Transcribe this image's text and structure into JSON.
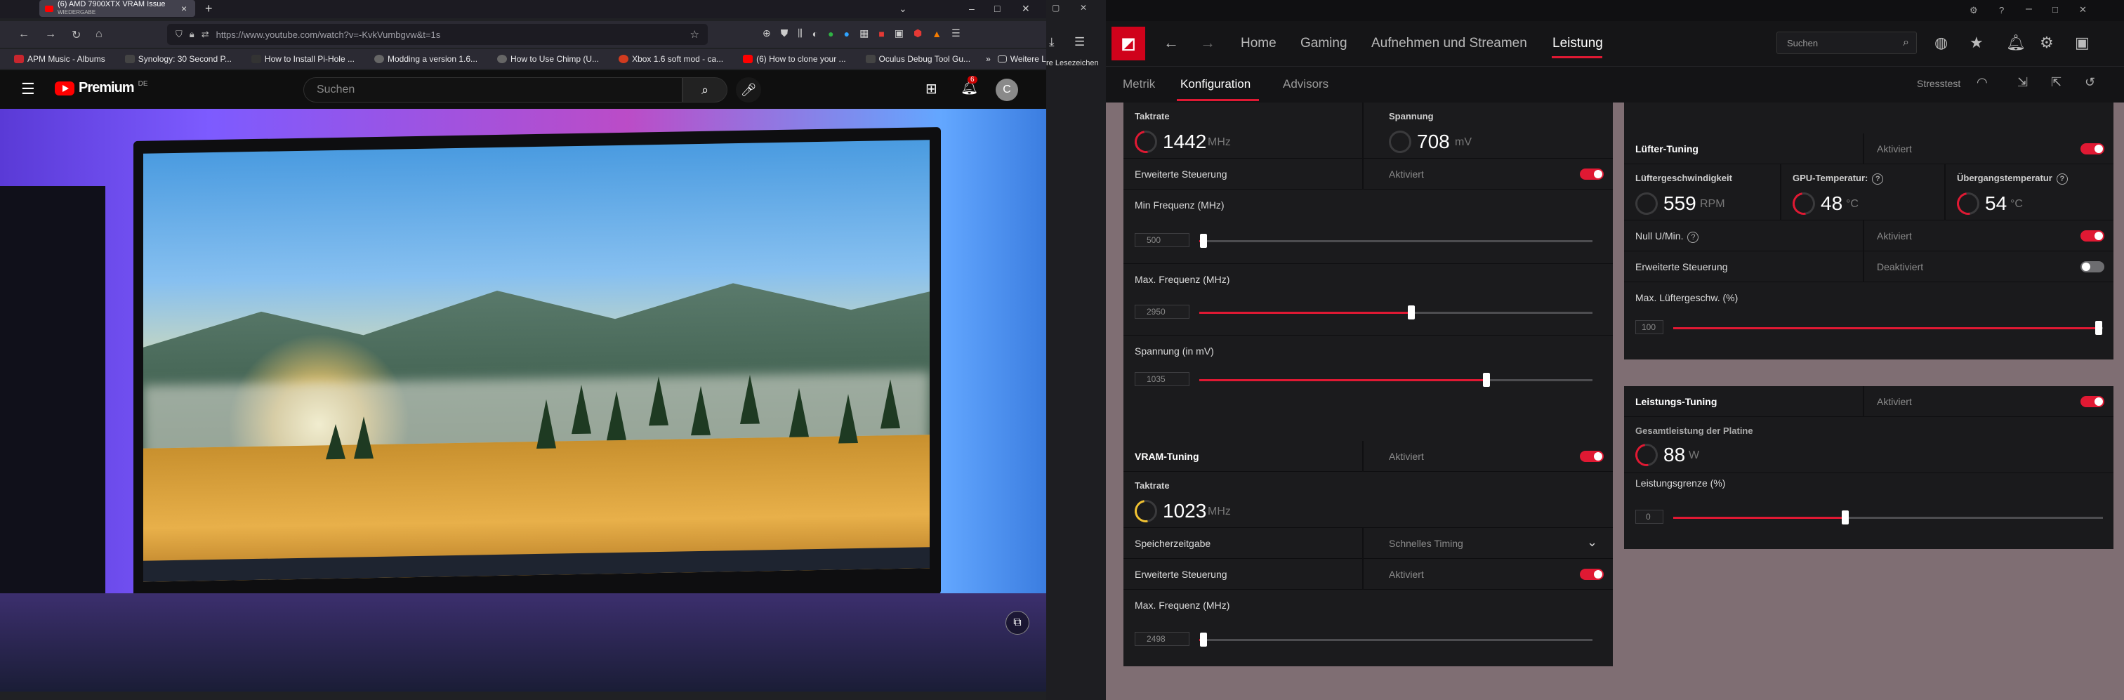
{
  "browser": {
    "tab_title": "(6) AMD 7900XTX VRAM Issue",
    "tab_subtitle": "WIEDERGABE",
    "new_tab": "+",
    "url": "https://www.youtube.com/watch?v=-KvkVumbgvw&t=1s",
    "bookmarks": [
      {
        "label": "APM Music - Albums",
        "color": "#c8262e"
      },
      {
        "label": "Synology: 30 Second P...",
        "color": "#444"
      },
      {
        "label": "How to Install Pi-Hole ...",
        "color": "#333"
      },
      {
        "label": "Modding a version 1.6...",
        "color": "#666"
      },
      {
        "label": "How to Use Chimp (U...",
        "color": "#666"
      },
      {
        "label": "Xbox 1.6 soft mod - ca...",
        "color": "#d13b1f"
      },
      {
        "label": "(6) How to clone your ...",
        "color": "#ff0000"
      },
      {
        "label": "Oculus Debug Tool Gu...",
        "color": "#444"
      }
    ],
    "bookmarks_more": "»",
    "other_bookmarks": "Weitere Lesezeichen",
    "right_fragment": "re Lesezeichen"
  },
  "youtube": {
    "logo_text": "Premium",
    "logo_region": "DE",
    "search_placeholder": "Suchen",
    "notification_count": "6",
    "avatar_letter": "C"
  },
  "amd": {
    "nav": [
      "Home",
      "Gaming",
      "Aufnehmen und Streamen",
      "Leistung"
    ],
    "active_nav": "Leistung",
    "search_placeholder": "Suchen",
    "subnav": [
      "Metrik",
      "Konfiguration",
      "Advisors"
    ],
    "stresstest_label": "Stresstest",
    "gpu": {
      "clock_label": "Taktrate",
      "clock_value": "1442",
      "clock_unit": "MHz",
      "voltage_label": "Spannung",
      "voltage_value": "708",
      "voltage_unit": "mV",
      "adv_label": "Erweiterte Steuerung",
      "adv_status": "Aktiviert",
      "min_freq_label": "Min Frequenz (MHz)",
      "min_freq_value": "500",
      "min_freq_pos": 0.01,
      "max_freq_label": "Max. Frequenz (MHz)",
      "max_freq_value": "2950",
      "max_freq_pos": 0.54,
      "volt_label": "Spannung (in mV)",
      "volt_value": "1035",
      "volt_pos": 0.73
    },
    "vram": {
      "title": "VRAM-Tuning",
      "status": "Aktiviert",
      "clock_label": "Taktrate",
      "clock_value": "1023",
      "clock_unit": "MHz",
      "timing_label": "Speicherzeitgabe",
      "timing_value": "Schnelles Timing",
      "adv_label": "Erweiterte Steuerung",
      "adv_status": "Aktiviert",
      "max_freq_label": "Max. Frequenz (MHz)",
      "max_freq_value": "2498",
      "max_freq_pos": 0.01
    },
    "fan": {
      "title": "Lüfter-Tuning",
      "status": "Aktiviert",
      "speed_label": "Lüftergeschwindigkeit",
      "speed_value": "559",
      "speed_unit": "RPM",
      "gpu_temp_label": "GPU-Temperatur:",
      "gpu_temp_value": "48",
      "gpu_temp_unit": "°C",
      "junction_label": "Übergangstemperatur",
      "junction_value": "54",
      "junction_unit": "°C",
      "zero_rpm_label": "Null U/Min.",
      "zero_rpm_status": "Aktiviert",
      "adv_label": "Erweiterte Steuerung",
      "adv_status": "Deaktiviert",
      "max_speed_label": "Max. Lüftergeschw. (%)",
      "max_speed_value": "100",
      "max_speed_pos": 0.99
    },
    "power": {
      "title": "Leistungs-Tuning",
      "status": "Aktiviert",
      "board_label": "Gesamtleistung der Platine",
      "board_value": "88",
      "board_unit": "W",
      "limit_label": "Leistungsgrenze (%)",
      "limit_value": "0",
      "limit_pos": 0.4
    }
  }
}
